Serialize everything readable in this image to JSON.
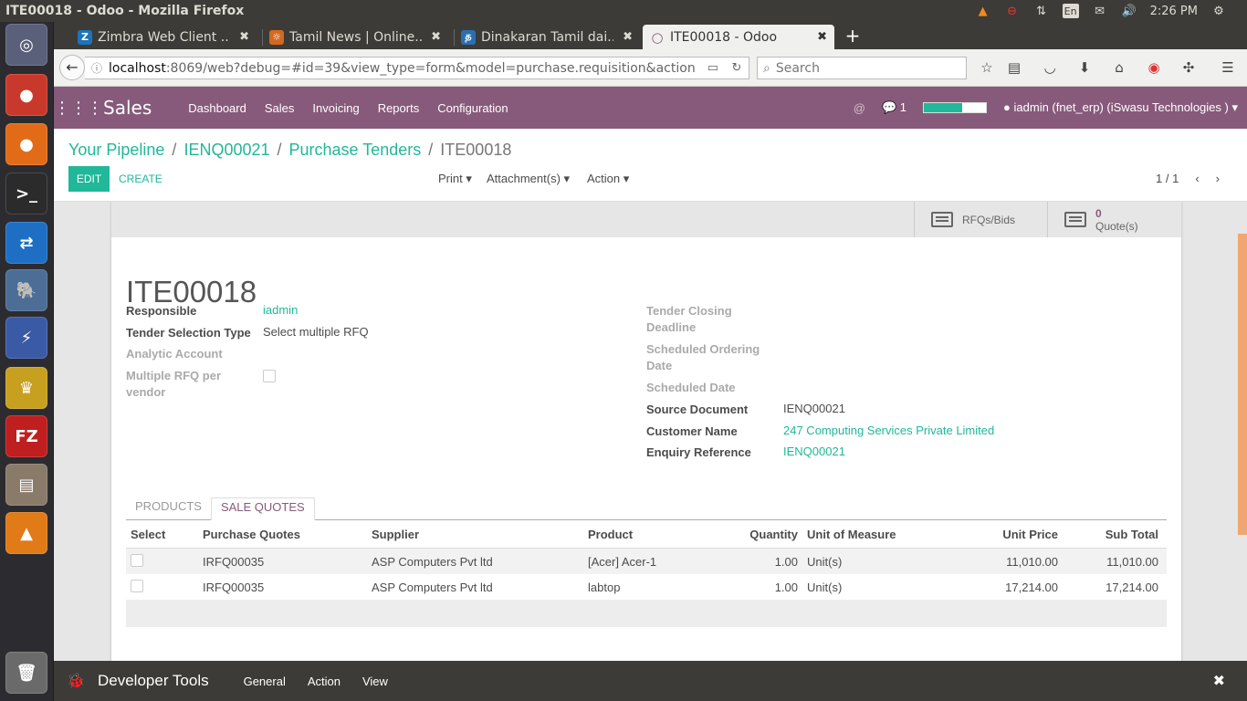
{
  "window": {
    "title": "ITE00018 - Odoo - Mozilla Firefox"
  },
  "tray": {
    "keyboard": "En",
    "time": "2:26 PM"
  },
  "launcher": {
    "items": [
      {
        "name": "ubuntu-dash",
        "glyph": "◎",
        "color": "#5a5f7a"
      },
      {
        "name": "chrome",
        "glyph": "●",
        "color": "#c9392b"
      },
      {
        "name": "firefox",
        "glyph": "●",
        "color": "#e26b17"
      },
      {
        "name": "terminal",
        "glyph": ">_",
        "color": "#2b2b2b"
      },
      {
        "name": "teamviewer",
        "glyph": "⇄",
        "color": "#1e6fc4"
      },
      {
        "name": "pgadmin",
        "glyph": "🐘",
        "color": "#4b6d96"
      },
      {
        "name": "remote-desktop",
        "glyph": "⚡",
        "color": "#3a5aa6"
      },
      {
        "name": "genie",
        "glyph": "♛",
        "color": "#c8a020"
      },
      {
        "name": "filezilla",
        "glyph": "FZ",
        "color": "#bf1f1f"
      },
      {
        "name": "files",
        "glyph": "▤",
        "color": "#8a7a6a"
      },
      {
        "name": "vlc",
        "glyph": "▲",
        "color": "#e07b17"
      },
      {
        "name": "trash",
        "glyph": "🗑",
        "color": "#6a6a6a"
      }
    ]
  },
  "browser": {
    "tabs": [
      {
        "label": "Zimbra Web Client ...",
        "favicon": "Z",
        "favcolor": "#1f73b7"
      },
      {
        "label": "Tamil News | Online...",
        "favicon": "☼",
        "favcolor": "#d2691e"
      },
      {
        "label": "Dinakaran Tamil dai...",
        "favicon": "த",
        "favcolor": "#2a6fb0"
      },
      {
        "label": "ITE00018 - Odoo",
        "favicon": "○",
        "favcolor": "#875a7b"
      }
    ],
    "url_host": "localhost",
    "url_rest": ":8069/web?debug=#id=39&view_type=form&model=purchase.requisition&action",
    "search_placeholder": "Search"
  },
  "odoo": {
    "app_name": "Sales",
    "menu": [
      "Dashboard",
      "Sales",
      "Invoicing",
      "Reports",
      "Configuration"
    ],
    "message_count": "1",
    "progress": 0.62,
    "user": "iadmin (fnet_erp) (iSwasu Technologies )",
    "breadcrumb": [
      "Your Pipeline",
      "IENQ00021",
      "Purchase Tenders",
      "ITE00018"
    ],
    "buttons": {
      "edit": "EDIT",
      "create": "CREATE",
      "print": "Print",
      "attachments": "Attachment(s)",
      "action": "Action"
    },
    "pager": "1 / 1",
    "smart_buttons": {
      "rfqs": "RFQs/Bids",
      "quotes_count": "0",
      "quotes_label": "Quote(s)"
    },
    "record": {
      "name": "ITE00018",
      "responsible_label": "Responsible",
      "responsible": "iadmin",
      "selection_type_label": "Tender Selection Type",
      "selection_type": "Select multiple RFQ",
      "analytic_label": "Analytic Account",
      "multi_rfq_label_1": "Multiple RFQ per",
      "multi_rfq_label_2": "vendor",
      "closing_label_1": "Tender Closing",
      "closing_label_2": "Deadline",
      "ordering_label_1": "Scheduled Ordering",
      "ordering_label_2": "Date",
      "scheduled_label": "Scheduled Date",
      "source_label": "Source Document",
      "source": "IENQ00021",
      "customer_label": "Customer Name",
      "customer": "247 Computing Services Private Limited",
      "enquiry_label": "Enquiry Reference",
      "enquiry": "IENQ00021"
    },
    "tabs": [
      "PRODUCTS",
      "SALE QUOTES"
    ],
    "table": {
      "headers": [
        "Select",
        "Purchase Quotes",
        "Supplier",
        "Product",
        "Quantity",
        "Unit of Measure",
        "Unit Price",
        "Sub Total"
      ],
      "rows": [
        {
          "quote": "IRFQ00035",
          "supplier": "ASP Computers Pvt ltd",
          "product": "[Acer] Acer-1",
          "qty": "1.00",
          "uom": "Unit(s)",
          "price": "11,010.00",
          "subtotal": "11,010.00"
        },
        {
          "quote": "IRFQ00035",
          "supplier": "ASP Computers Pvt ltd",
          "product": "labtop",
          "qty": "1.00",
          "uom": "Unit(s)",
          "price": "17,214.00",
          "subtotal": "17,214.00"
        }
      ]
    }
  },
  "devtools": {
    "title": "Developer Tools",
    "menu": [
      "General",
      "Action",
      "View"
    ]
  }
}
